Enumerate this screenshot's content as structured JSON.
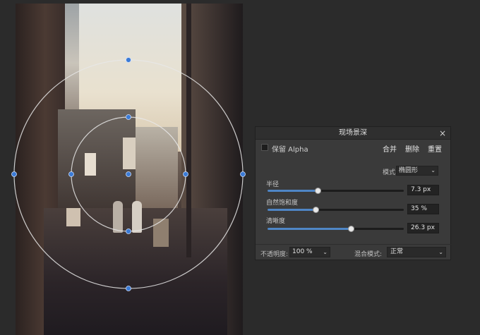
{
  "colors": {
    "accent": "#4f86c6",
    "handle": "#3b7bd6",
    "guide": "#e8e8e8",
    "panel_bg": "#3a3a3a"
  },
  "panel": {
    "title": "现场景深",
    "close_icon": "×",
    "preserve_alpha_label": "保留 Alpha",
    "preserve_alpha_checked": false,
    "merge_label": "合并",
    "delete_label": "删除",
    "reset_label": "重置",
    "mode_label": "模式",
    "mode_value": "椭圆形",
    "sliders": [
      {
        "label": "半径",
        "value_text": "7.3 px",
        "fraction": 0.37
      },
      {
        "label": "自然饱和度",
        "value_text": "35 %",
        "fraction": 0.35
      },
      {
        "label": "清晰度",
        "value_text": "26.3 px",
        "fraction": 0.61
      }
    ],
    "opacity_label": "不透明度:",
    "opacity_value": "100 %",
    "blend_label": "混合模式:",
    "blend_value": "正常"
  }
}
